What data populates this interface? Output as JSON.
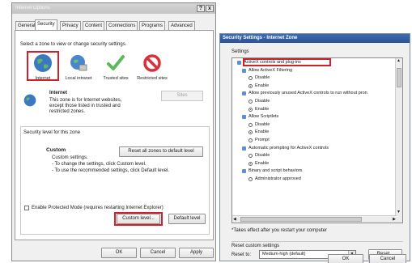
{
  "internet_options": {
    "title": "Internet Options",
    "help_btn": "?",
    "close_btn": "x",
    "tabs": [
      "General",
      "Security",
      "Privacy",
      "Content",
      "Connections",
      "Programs",
      "Advanced"
    ],
    "zone_prompt": "Select a zone to view or change security settings.",
    "zones": [
      "Internet",
      "Local intranet",
      "Trusted sites",
      "Restricted sites"
    ],
    "zone_name": "Internet",
    "zone_desc": [
      "This zone is for Internet websites,",
      "except those listed in trusted and",
      "restricted zones."
    ],
    "sites_btn": "Sites",
    "security_level_header": "Security level for this zone",
    "custom_title": "Custom",
    "custom_lines": [
      "Custom settings.",
      "- To change the settings, click Custom level.",
      "- To use the recommended settings, click Default level."
    ],
    "protected_mode": "Enable Protected Mode (requires restarting Internet Explorer)",
    "custom_level_btn": "Custom level...",
    "default_level_btn": "Default level",
    "reset_all_btn": "Reset all zones to default level",
    "ok_btn": "OK",
    "cancel_btn": "Cancel",
    "apply_btn": "Apply"
  },
  "security_settings": {
    "title": "Security Settings - Internet Zone",
    "settings_label": "Settings",
    "tree": [
      {
        "text": "ActiveX controls and plug-ins",
        "kind": "category"
      },
      {
        "text": "Allow ActiveX Filtering",
        "kind": "setting"
      },
      {
        "text": "Disable",
        "kind": "radio",
        "on": false
      },
      {
        "text": "Enable",
        "kind": "radio",
        "on": true
      },
      {
        "text": "Allow previously unused ActiveX controls to run without pron",
        "kind": "setting"
      },
      {
        "text": "Disable",
        "kind": "radio",
        "on": false
      },
      {
        "text": "Enable",
        "kind": "radio",
        "on": true
      },
      {
        "text": "Allow Scriptlets",
        "kind": "setting"
      },
      {
        "text": "Disable",
        "kind": "radio",
        "on": false
      },
      {
        "text": "Enable",
        "kind": "radio",
        "on": true
      },
      {
        "text": "Prompt",
        "kind": "radio",
        "on": false
      },
      {
        "text": "Automatic prompting for ActiveX controls",
        "kind": "setting"
      },
      {
        "text": "Disable",
        "kind": "radio",
        "on": false
      },
      {
        "text": "Enable",
        "kind": "radio",
        "on": true
      },
      {
        "text": "Binary and script behaviors",
        "kind": "setting"
      },
      {
        "text": "Administrator approved",
        "kind": "radio",
        "on": false
      }
    ],
    "restart_note": "*Takes effect after you restart your computer",
    "reset_custom_label": "Reset custom settings",
    "reset_to_label": "Reset to:",
    "reset_to_value": "Medium-high (default)",
    "reset_btn": "Reset...",
    "ok_btn": "OK",
    "cancel_btn": "Cancel"
  },
  "colors": {
    "highlight_red": "#d0202a",
    "title_blue": "#2a5596"
  }
}
